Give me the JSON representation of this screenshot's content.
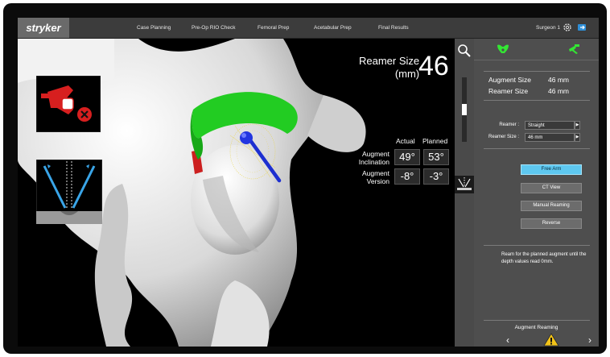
{
  "topbar": {
    "brand": "stryker",
    "nav": [
      "Case Planning",
      "Pre-Op RIO Check",
      "Femoral Prep",
      "Acetabular Prep",
      "Final Results"
    ],
    "user": "Surgeon 1",
    "icons": [
      "gear-icon",
      "exit-icon"
    ]
  },
  "viewport": {
    "reamer_size_label_1": "Reamer Size",
    "reamer_size_label_2": "(mm)",
    "reamer_size_value": "46",
    "col_actual": "Actual",
    "col_planned": "Planned",
    "rows": [
      {
        "label_1": "Augment",
        "label_2": "Inclination",
        "actual": "49°",
        "planned": "53°"
      },
      {
        "label_1": "Augment",
        "label_2": "Version",
        "actual": "-8°",
        "planned": "-3°"
      }
    ],
    "colors": {
      "green": "#22cc22",
      "blue": "#1d2fd0",
      "red": "#cc1f1f",
      "yellow": "#e8d23c"
    }
  },
  "strip": {
    "icons": [
      "zoom-icon",
      "reamer-view-icon"
    ],
    "scroll_fraction": 0.5
  },
  "panel": {
    "augment_size_label": "Augment Size",
    "augment_size_value": "46 mm",
    "reamer_size_label": "Reamer Size",
    "reamer_size_value": "46 mm",
    "reamer_select_label": "Reamer :",
    "reamer_select_value": "Straight",
    "reamer_size_select_label": "Reamer Size :",
    "reamer_size_select_value": "46 mm",
    "buttons": [
      "Free Arm",
      "CT View",
      "Manual Reaming",
      "Reverse"
    ],
    "active_button": "Free Arm",
    "instruction": "Ream for the planned augment until the depth values read 0mm.",
    "footer_title": "Augment Reaming",
    "accent": "#5ec8f0"
  }
}
